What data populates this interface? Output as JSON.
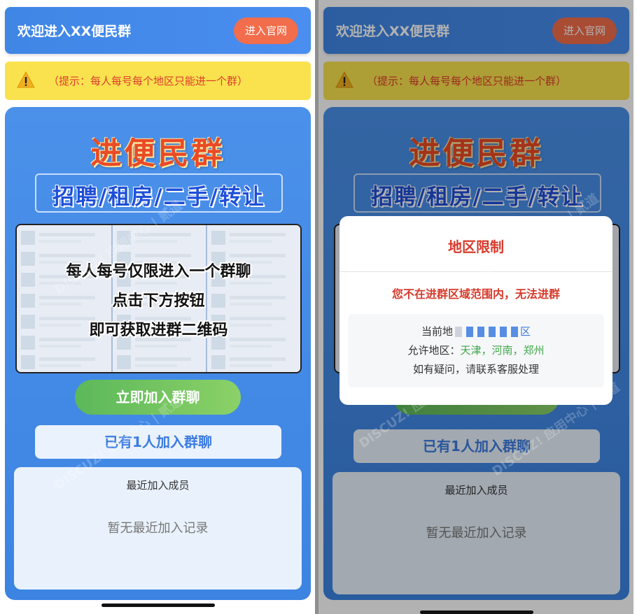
{
  "header": {
    "title": "欢迎进入XX便民群",
    "site_button": "进入官网"
  },
  "notice": {
    "text": "（提示：每人每号每个地区只能进一个群）"
  },
  "hero": {
    "title": "进便民群",
    "subtitle": "招聘/租房/二手/转让"
  },
  "preview": {
    "lines": [
      "每人每号仅限进入一个群聊",
      "点击下方按钮",
      "即可获取进群二维码"
    ]
  },
  "join_button": "立即加入群聊",
  "joined_count": "已有1人加入群聊",
  "recent": {
    "title": "最近加入成员",
    "empty": "暂无最近加入记录"
  },
  "modal": {
    "title": "地区限制",
    "message": "您不在进群区域范围内，无法进群",
    "current_label": "当前地",
    "current_suffix": "区",
    "allowed_label": "允许地区：",
    "allowed_regions": "天津，河南，郑州",
    "help": "如有疑问，请联系客服处理"
  },
  "watermark": "DISCUZ! 应用中心 | 贰道"
}
